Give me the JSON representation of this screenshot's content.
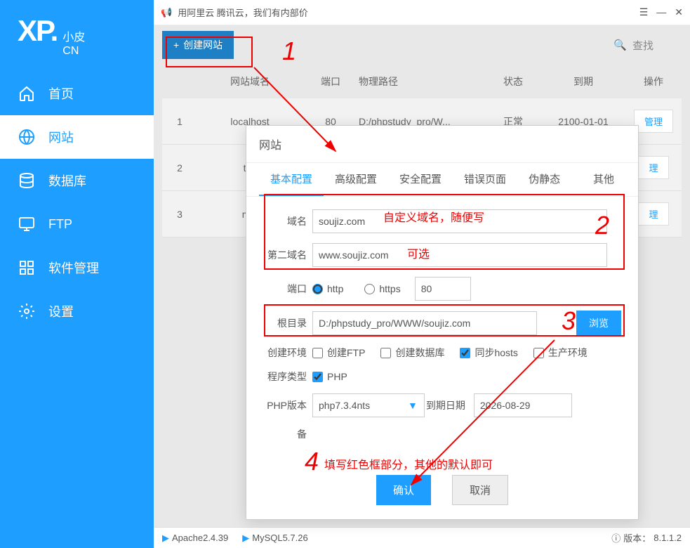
{
  "logo": {
    "main": "XP.",
    "sub1": "小皮",
    "sub2": "CN"
  },
  "titlebar": {
    "announcement": "用阿里云 腾讯云，我们有内部价"
  },
  "sidebar": {
    "items": [
      {
        "label": "首页"
      },
      {
        "label": "网站"
      },
      {
        "label": "数据库"
      },
      {
        "label": "FTP"
      },
      {
        "label": "软件管理"
      },
      {
        "label": "设置"
      }
    ]
  },
  "toolbar": {
    "create_label": "创建网站",
    "search_label": "查找"
  },
  "table": {
    "headers": {
      "domain": "网站域名",
      "port": "端口",
      "path": "物理路径",
      "status": "状态",
      "expire": "到期",
      "action": "操作"
    },
    "rows": [
      {
        "idx": "1",
        "domain": "localhost",
        "port": "80",
        "path": "D:/phpstudy_pro/W...",
        "status": "正常",
        "expire": "2100-01-01",
        "action": "管理"
      },
      {
        "idx": "2",
        "domain": "typ",
        "port": "",
        "path": "",
        "status": "",
        "expire": "",
        "action": "理"
      },
      {
        "idx": "3",
        "domain": "myt",
        "port": "",
        "path": "",
        "status": "",
        "expire": "",
        "action": "理"
      }
    ]
  },
  "modal": {
    "title": "网站",
    "tabs": [
      {
        "label": "基本配置"
      },
      {
        "label": "高级配置"
      },
      {
        "label": "安全配置"
      },
      {
        "label": "错误页面"
      },
      {
        "label": "伪静态"
      },
      {
        "label": "其他"
      }
    ],
    "form": {
      "domain_label": "域名",
      "domain_value": "soujiz.com",
      "domain2_label": "第二域名",
      "domain2_value": "www.soujiz.com",
      "port_label": "端口",
      "http_label": "http",
      "https_label": "https",
      "port_value": "80",
      "root_label": "根目录",
      "root_value": "D:/phpstudy_pro/WWW/soujiz.com",
      "browse_label": "浏览",
      "env_label": "创建环境",
      "env_ftp": "创建FTP",
      "env_db": "创建数据库",
      "env_hosts": "同步hosts",
      "env_prod": "生产环境",
      "type_label": "程序类型",
      "type_php": "PHP",
      "phpver_label": "PHP版本",
      "phpver_value": "php7.3.4nts",
      "expire_label": "到期日期",
      "expire_value": "2026-08-29",
      "note_label": "备",
      "confirm": "确认",
      "cancel": "取消"
    }
  },
  "statusbar": {
    "apache": "Apache2.4.39",
    "mysql": "MySQL5.7.26",
    "version_label": "版本：",
    "version_value": "8.1.1.2"
  },
  "annotations": {
    "n1": "1",
    "n2": "2",
    "n3": "3",
    "n4": "4",
    "domain_hint": "自定义域名，随便写",
    "domain2_hint": "可选",
    "note_hint": "填写红色框部分，其他的默认即可"
  }
}
